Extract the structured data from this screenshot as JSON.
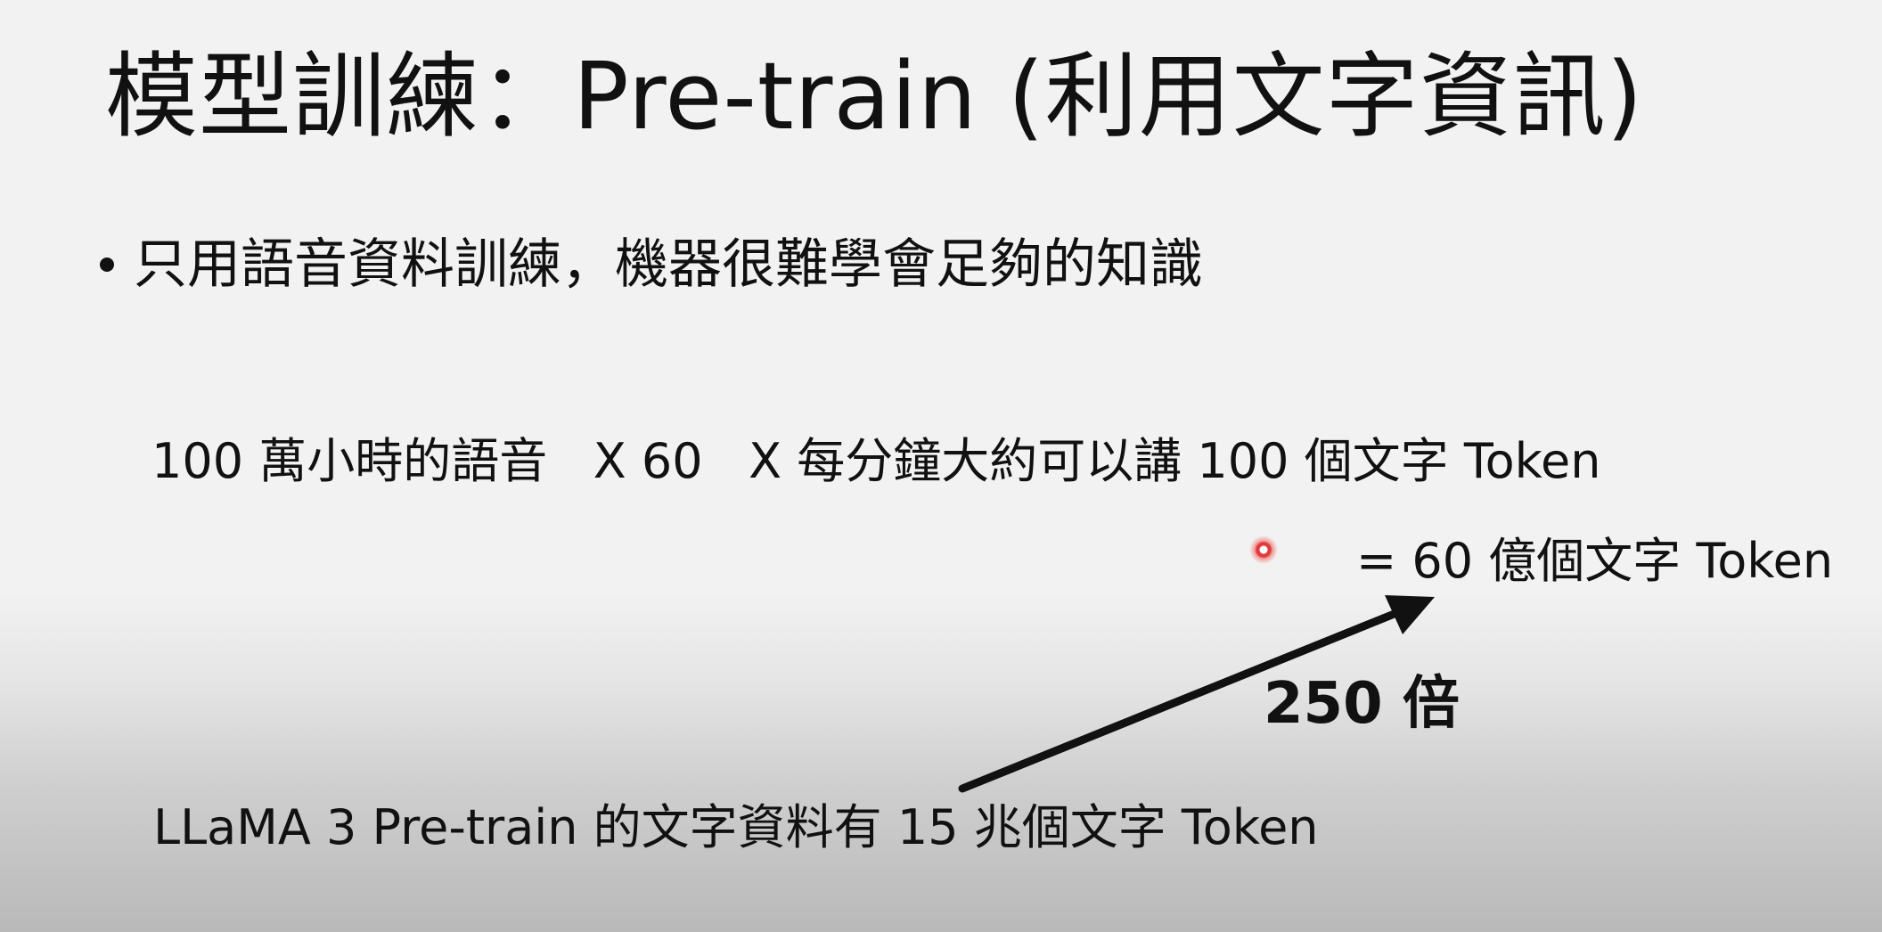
{
  "slide": {
    "title": "模型訓練：Pre-train (利用文字資訊)",
    "bullet": "只用語音資料訓練，機器很難學會足夠的知識",
    "calc_line": "100 萬小時的語音   X 60   X 每分鐘大約可以講 100 個文字 Token",
    "result_line": "= 60 億個文字 Token",
    "ratio_label": "250 倍",
    "llama_line": "LLaMA 3 Pre-train 的文字資料有 15 兆個文字 Token"
  },
  "colors": {
    "text": "#111111",
    "background_top": "#f2f2f2",
    "background_bottom": "#b9b9b9",
    "laser_pointer": "#e23b3b"
  },
  "icons": {
    "arrow": "arrow-up-right-icon",
    "pointer": "laser-pointer-icon"
  }
}
